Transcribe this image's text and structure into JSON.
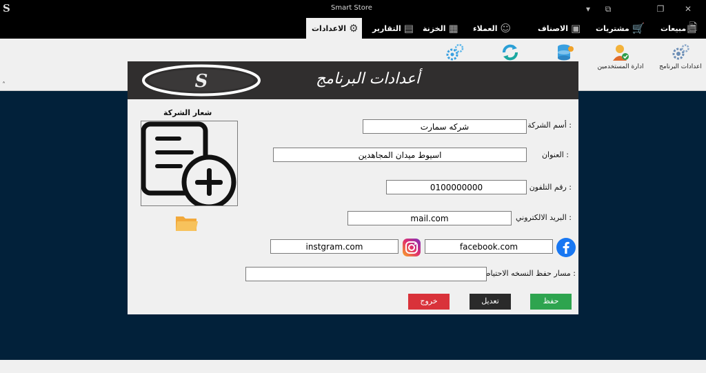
{
  "window": {
    "title": "Smart Store",
    "logo_letter": "S",
    "controls": {
      "dropdown": "▾",
      "restore_small": "⧉",
      "maximize": "❐",
      "close": "✕"
    }
  },
  "tabs": [
    {
      "label": "مبيعات",
      "icon": "sales-icon"
    },
    {
      "label": "مشتريات",
      "icon": "cart-icon"
    },
    {
      "label": "الاصناف",
      "icon": "box-icon"
    },
    {
      "label": "العملاء",
      "icon": "person-icon"
    },
    {
      "label": "الخزنة",
      "icon": "safe-icon"
    },
    {
      "label": "التقارير",
      "icon": "reports-icon"
    },
    {
      "label": "الاعدادات",
      "icon": "gear-icon",
      "active": true
    }
  ],
  "ribbon": {
    "buttons": [
      {
        "label": "اعدادات البرنامج",
        "icon": "program-settings-icon"
      },
      {
        "label": "ادارة المستخدمين",
        "icon": "user-management-icon"
      },
      {
        "label": "",
        "icon": "database-icon"
      },
      {
        "label": "",
        "icon": "refresh-icon"
      },
      {
        "label": "",
        "icon": "gears-icon"
      }
    ],
    "collapse": "˄"
  },
  "dialog": {
    "title": "أعدادات البرنامج",
    "logo_text": "S",
    "logo_caption": "شعار الشركة",
    "fields": {
      "company_name": {
        "label": "أسم الشركة :",
        "value": "شركه سمارت"
      },
      "address": {
        "label": "العنوان :",
        "value": "اسيوط ميدان المجاهدين"
      },
      "phone": {
        "label": "رقم التلفون :",
        "value": "0100000000"
      },
      "email": {
        "label": "البريد الالكتروني :",
        "value": "mail.com"
      },
      "facebook": {
        "value": "facebook.com"
      },
      "instagram": {
        "value": "instgram.com"
      },
      "backup_path": {
        "label": "مسار حفظ النسخه الاحتياطية :",
        "value": ""
      }
    },
    "buttons": {
      "save": "حفظ",
      "edit": "تعديل",
      "exit": "خروج"
    },
    "colors": {
      "save": "#2ea44f",
      "edit": "#2a2a2a",
      "exit": "#d9323a",
      "header": "#302e2e",
      "workspace": "#02213a"
    }
  }
}
